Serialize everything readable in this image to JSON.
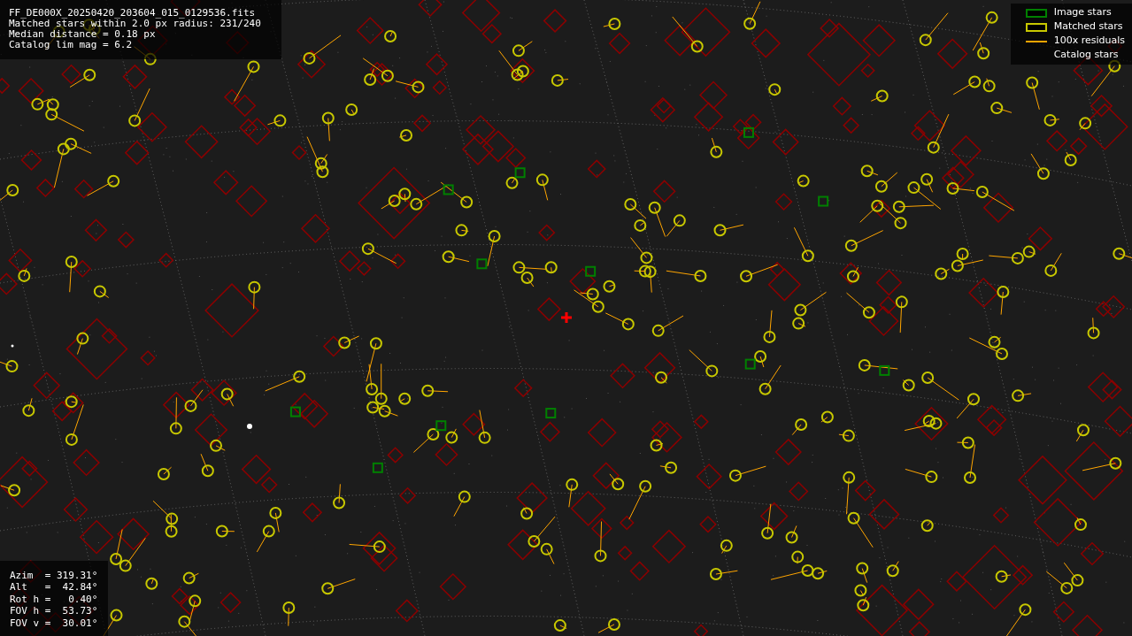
{
  "header": {
    "lines": [
      "FF_DE000X_20250420_203604_015_0129536.fits",
      "Matched stars within 2.0 px radius: 231/240",
      "Median distance = 0.18 px",
      "Catalog lim mag = 6.2"
    ]
  },
  "legend": [
    {
      "kind": "image",
      "label": "Image stars"
    },
    {
      "kind": "matched",
      "label": "Matched stars"
    },
    {
      "kind": "residual",
      "label": "100x residuals"
    },
    {
      "kind": "catalog",
      "label": "Catalog stars"
    }
  ],
  "pointing": {
    "lines": [
      "Azim  = 319.31°",
      "Alt   =  42.84°",
      "Rot h =   0.40°",
      "FOV h =  53.73°",
      "FOV v =  30.01°"
    ]
  }
}
